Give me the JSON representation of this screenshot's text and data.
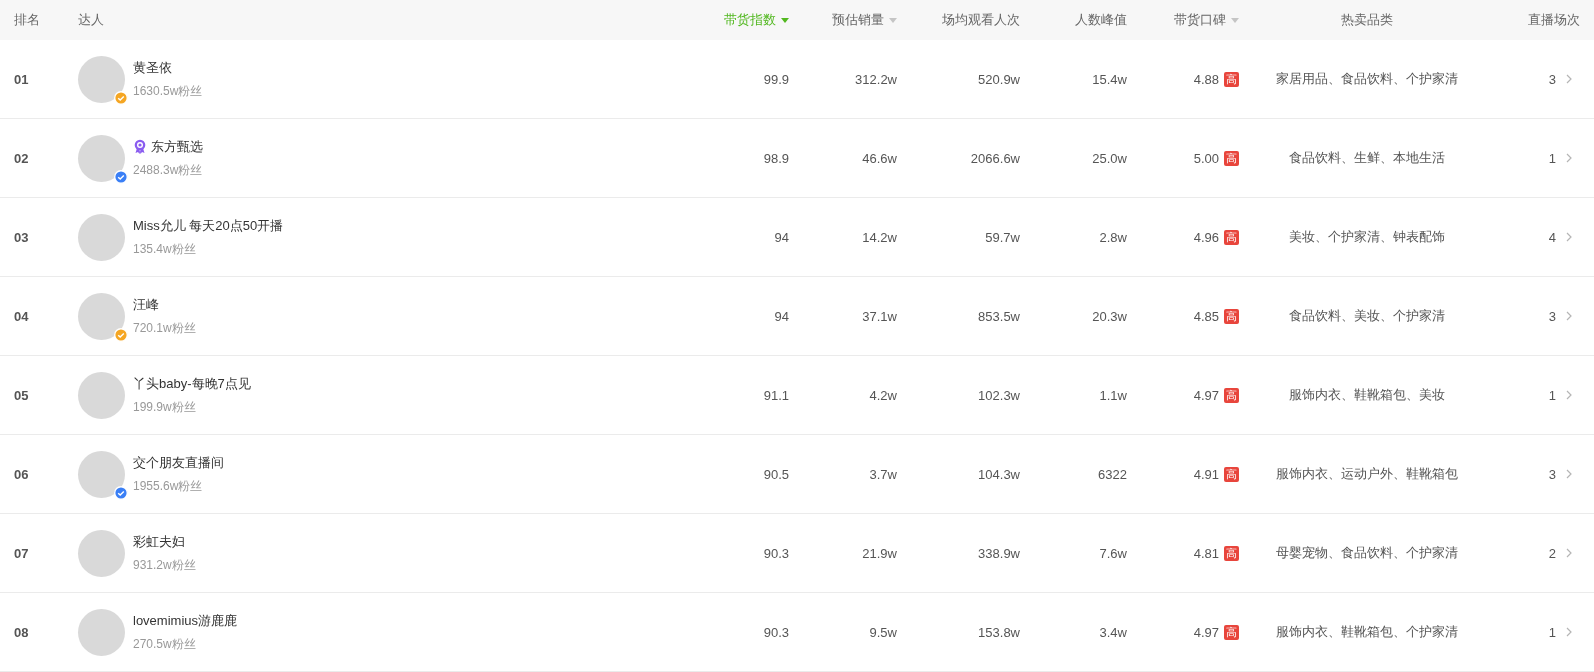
{
  "columns": [
    {
      "label": "排名",
      "sortable": false,
      "selected": false
    },
    {
      "label": "达人",
      "sortable": false,
      "selected": false
    },
    {
      "label": "带货指数",
      "sortable": true,
      "selected": true
    },
    {
      "label": "预估销量",
      "sortable": true,
      "selected": false
    },
    {
      "label": "场均观看人次",
      "sortable": false,
      "selected": false
    },
    {
      "label": "人数峰值",
      "sortable": false,
      "selected": false
    },
    {
      "label": "带货口碑",
      "sortable": true,
      "selected": false
    },
    {
      "label": "热卖品类",
      "sortable": false,
      "selected": false
    },
    {
      "label": "直播场次",
      "sortable": false,
      "selected": false
    }
  ],
  "rows": [
    {
      "rank": "01",
      "name": "黄圣依",
      "official": false,
      "verified_badge": {
        "color": "#f5a623"
      },
      "fans": "1630.5w粉丝",
      "index": "99.9",
      "sales": "312.2w",
      "avg_views": "520.9w",
      "peak": "15.4w",
      "rating": "4.88",
      "rating_tag": "高",
      "categories": "家居用品、食品饮料、个护家清",
      "sessions": "3"
    },
    {
      "rank": "02",
      "name": "东方甄选",
      "official": true,
      "verified_badge": {
        "color": "#3a7ff6"
      },
      "fans": "2488.3w粉丝",
      "index": "98.9",
      "sales": "46.6w",
      "avg_views": "2066.6w",
      "peak": "25.0w",
      "rating": "5.00",
      "rating_tag": "高",
      "categories": "食品饮料、生鲜、本地生活",
      "sessions": "1"
    },
    {
      "rank": "03",
      "name": "Miss允儿 每天20点50开播",
      "official": false,
      "fans": "135.4w粉丝",
      "index": "94",
      "sales": "14.2w",
      "avg_views": "59.7w",
      "peak": "2.8w",
      "rating": "4.96",
      "rating_tag": "高",
      "categories": "美妆、个护家清、钟表配饰",
      "sessions": "4"
    },
    {
      "rank": "04",
      "name": "汪峰",
      "official": false,
      "verified_badge": {
        "color": "#f5a623"
      },
      "fans": "720.1w粉丝",
      "index": "94",
      "sales": "37.1w",
      "avg_views": "853.5w",
      "peak": "20.3w",
      "rating": "4.85",
      "rating_tag": "高",
      "categories": "食品饮料、美妆、个护家清",
      "sessions": "3"
    },
    {
      "rank": "05",
      "name": "丫头baby-每晚7点见",
      "official": false,
      "fans": "199.9w粉丝",
      "index": "91.1",
      "sales": "4.2w",
      "avg_views": "102.3w",
      "peak": "1.1w",
      "rating": "4.97",
      "rating_tag": "高",
      "categories": "服饰内衣、鞋靴箱包、美妆",
      "sessions": "1"
    },
    {
      "rank": "06",
      "name": "交个朋友直播间",
      "official": false,
      "verified_badge": {
        "color": "#3a7ff6"
      },
      "fans": "1955.6w粉丝",
      "index": "90.5",
      "sales": "3.7w",
      "avg_views": "104.3w",
      "peak": "6322",
      "rating": "4.91",
      "rating_tag": "高",
      "categories": "服饰内衣、运动户外、鞋靴箱包",
      "sessions": "3"
    },
    {
      "rank": "07",
      "name": "彩虹夫妇",
      "official": false,
      "fans": "931.2w粉丝",
      "index": "90.3",
      "sales": "21.9w",
      "avg_views": "338.9w",
      "peak": "7.6w",
      "rating": "4.81",
      "rating_tag": "高",
      "categories": "母婴宠物、食品饮料、个护家清",
      "sessions": "2"
    },
    {
      "rank": "08",
      "name": "lovemimius游鹿鹿",
      "official": false,
      "fans": "270.5w粉丝",
      "index": "90.3",
      "sales": "9.5w",
      "avg_views": "153.8w",
      "peak": "3.4w",
      "rating": "4.97",
      "rating_tag": "高",
      "categories": "服饰内衣、鞋靴箱包、个护家清",
      "sessions": "1"
    }
  ]
}
